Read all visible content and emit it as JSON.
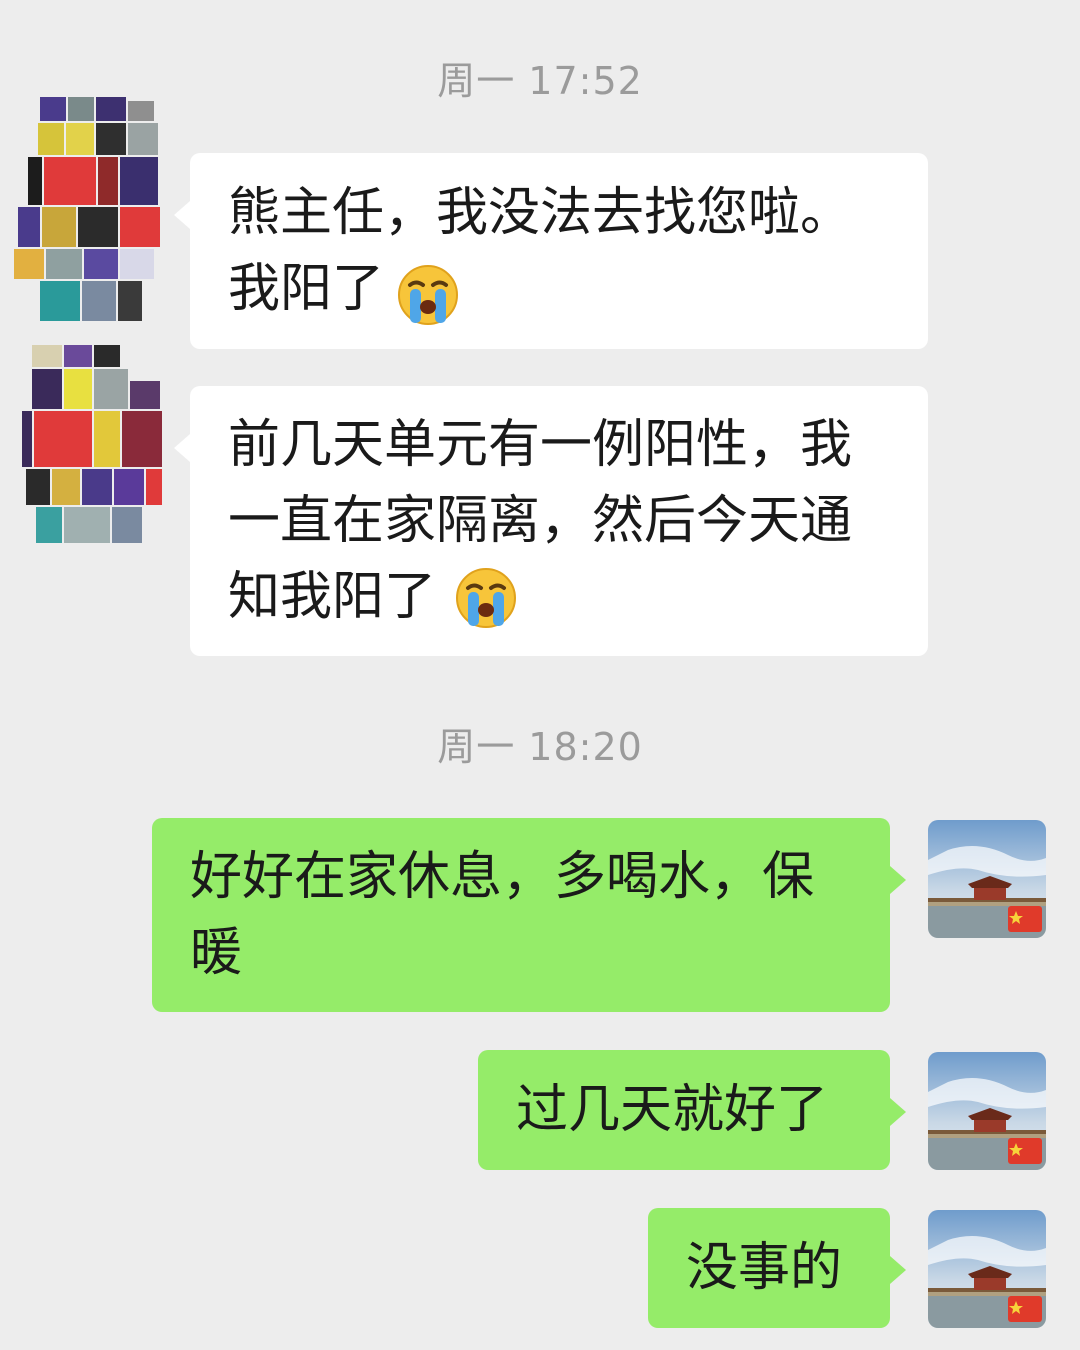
{
  "timestamps": [
    "周一 17:52",
    "周一 18:20"
  ],
  "incoming": [
    {
      "text": "熊主任，我没法去找您啦。\n我阳了",
      "emoji": "crying-face"
    },
    {
      "text": "前几天单元有一例阳性，我\n一直在家隔离，然后今天通\n知我阳了",
      "emoji": "crying-face"
    }
  ],
  "outgoing": [
    {
      "text": "好好在家休息，多喝水，保\n暖"
    },
    {
      "text": "过几天就好了"
    },
    {
      "text": "没事的"
    }
  ],
  "icons": {
    "contact_avatar": "mosaic-avatar-icon",
    "self_avatar": "palace-photo-avatar-icon",
    "flag": "china-flag-icon"
  },
  "colors": {
    "background": "#ededed",
    "incoming_bubble": "#ffffff",
    "outgoing_bubble": "#95ec69",
    "timestamp": "#9b9b9b"
  }
}
